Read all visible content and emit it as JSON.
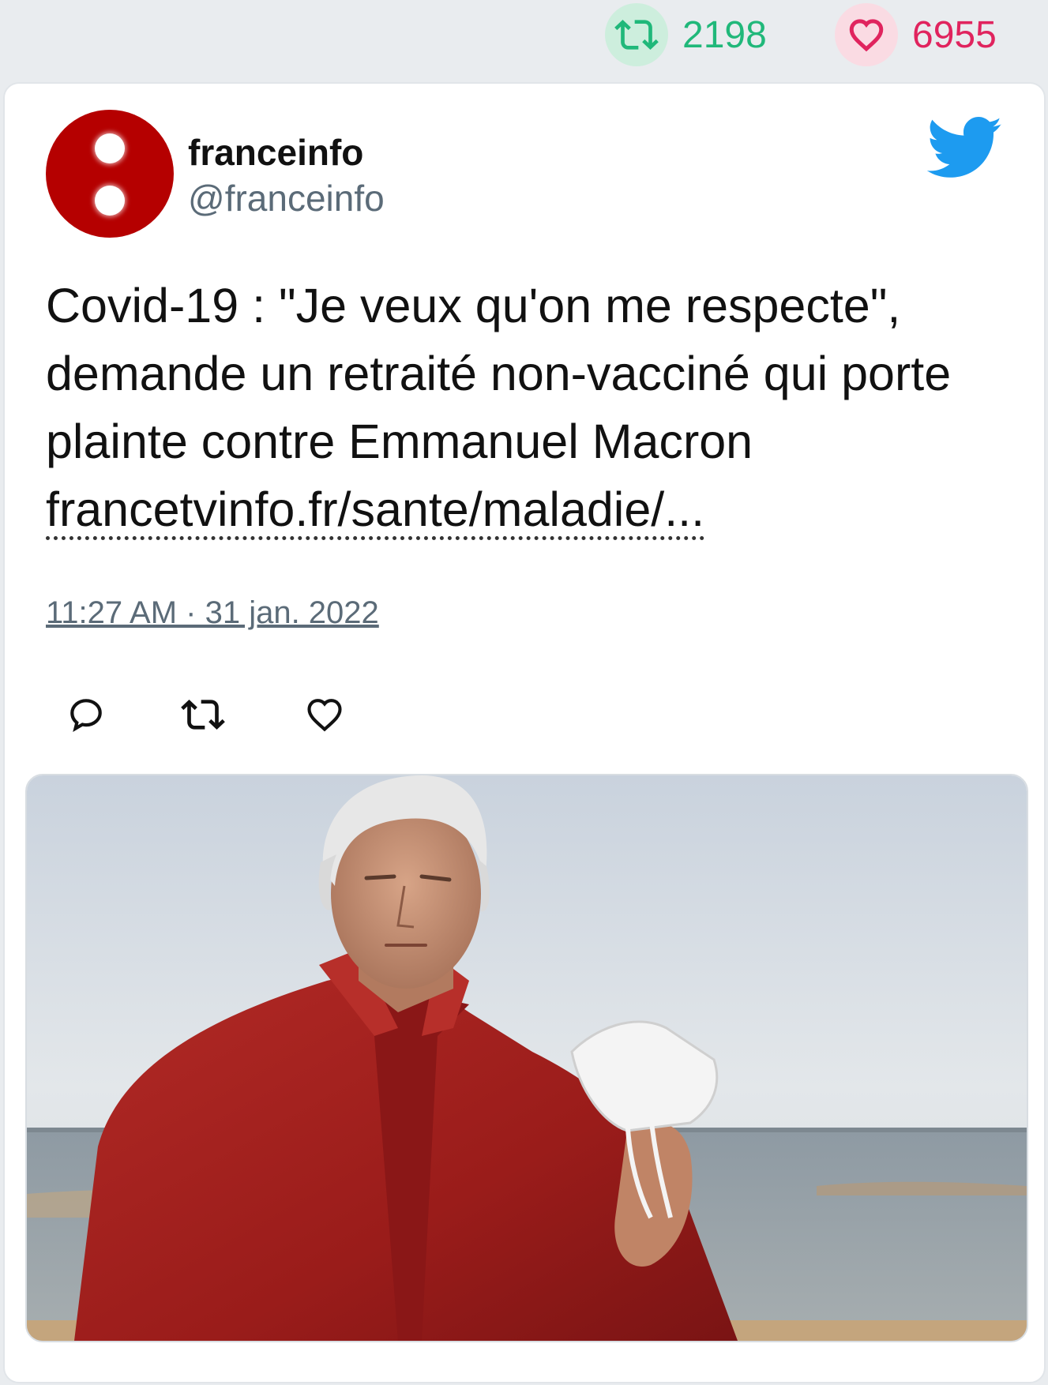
{
  "stats": {
    "retweets": "2198",
    "likes": "6955",
    "retweet_color": "#20b87a",
    "like_color": "#e0245e"
  },
  "tweet": {
    "author_name": "franceinfo",
    "author_handle": "@franceinfo",
    "text": "Covid-19 : \"Je veux qu'on me respecte\", demande un retraité non-vacciné qui porte plainte contre Emmanuel Macron",
    "link": "francetvinfo.fr/sante/maladie/...",
    "timestamp": "11:27 AM · 31 jan. 2022",
    "avatar_color": "#b50000",
    "brand_color": "#1d9bf0"
  },
  "icons": {
    "stats_retweet": "retweet-icon",
    "stats_like": "heart-icon",
    "brand": "twitter-bird-icon",
    "reply": "reply-icon",
    "retweet": "retweet-icon",
    "like": "heart-icon"
  }
}
